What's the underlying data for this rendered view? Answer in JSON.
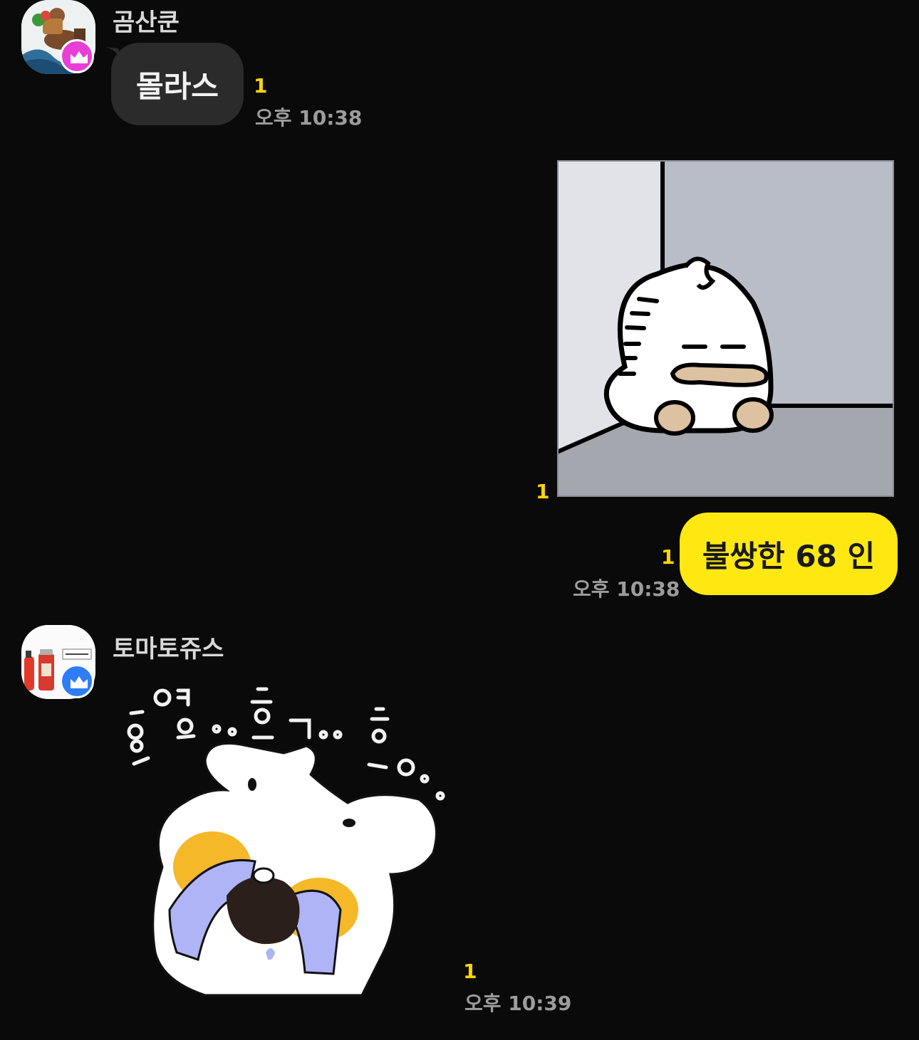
{
  "messages": [
    {
      "sender": "곰산쿤",
      "avatar_badge": "crown-icon",
      "badge_color": "#e83fd6",
      "text": "몰라스",
      "unread": "1",
      "time": "오후 10:38"
    },
    {
      "sticker": "sad-duck-corner-sticker",
      "unread": "1"
    },
    {
      "text": "불쌍한 68 인",
      "unread": "1",
      "time": "오후 10:38",
      "bubble_color": "#ffe812"
    },
    {
      "sender": "토마토쥬스",
      "avatar_badge": "crown-icon",
      "badge_color": "#2f7df6",
      "sticker": "crying-dog-sticker",
      "sticker_text": "흥엉..흐ㄱ..흥ㅇ..",
      "unread": "1",
      "time": "오후 10:39"
    }
  ]
}
